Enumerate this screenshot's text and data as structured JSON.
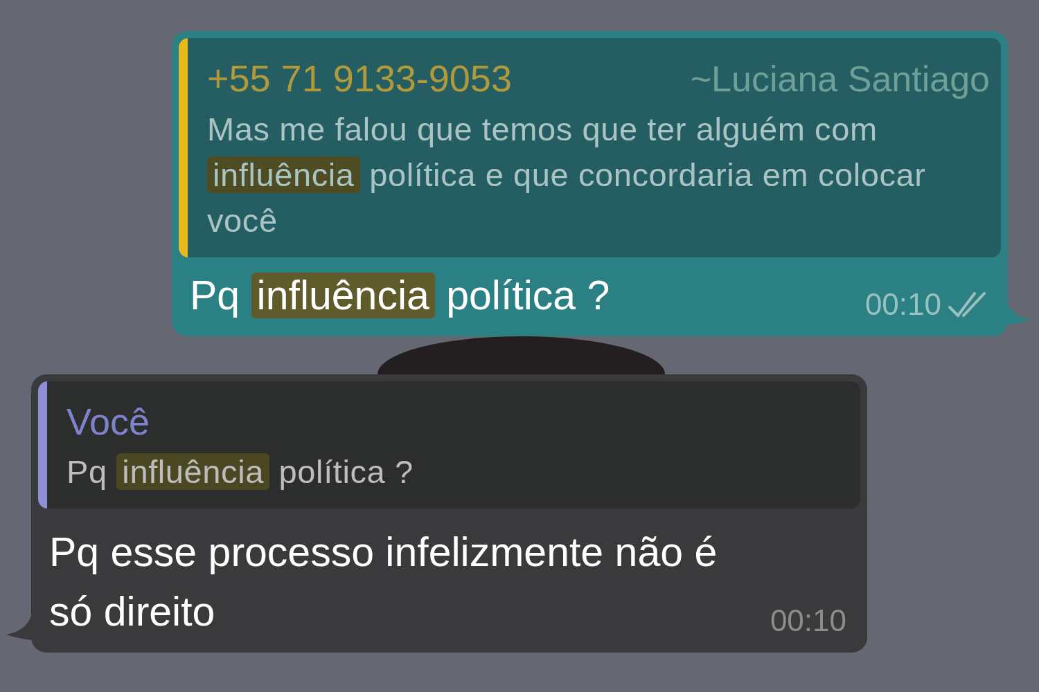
{
  "messages": [
    {
      "kind": "outgoing",
      "quote": {
        "author": "+55 71 9133-9053",
        "alias": "~Luciana Santiago",
        "segments": [
          {
            "text": "Mas me falou que temos que ter alguém com ",
            "highlighted": false
          },
          {
            "text": "influência",
            "highlighted": true
          },
          {
            "text": " política e que concordaria em colocar você",
            "highlighted": false
          }
        ]
      },
      "segments": [
        {
          "text": "Pq ",
          "highlighted": false
        },
        {
          "text": "influência",
          "highlighted": true
        },
        {
          "text": " política ?",
          "highlighted": false
        }
      ],
      "time": "00:10",
      "read": true
    },
    {
      "kind": "incoming",
      "quote": {
        "author": "Você",
        "segments": [
          {
            "text": "Pq ",
            "highlighted": false
          },
          {
            "text": "influência",
            "highlighted": true
          },
          {
            "text": " política ?",
            "highlighted": false
          }
        ]
      },
      "segments": [
        {
          "text": "Pq esse processo infelizmente não é só direito",
          "highlighted": false
        }
      ],
      "time": "00:10"
    }
  ]
}
